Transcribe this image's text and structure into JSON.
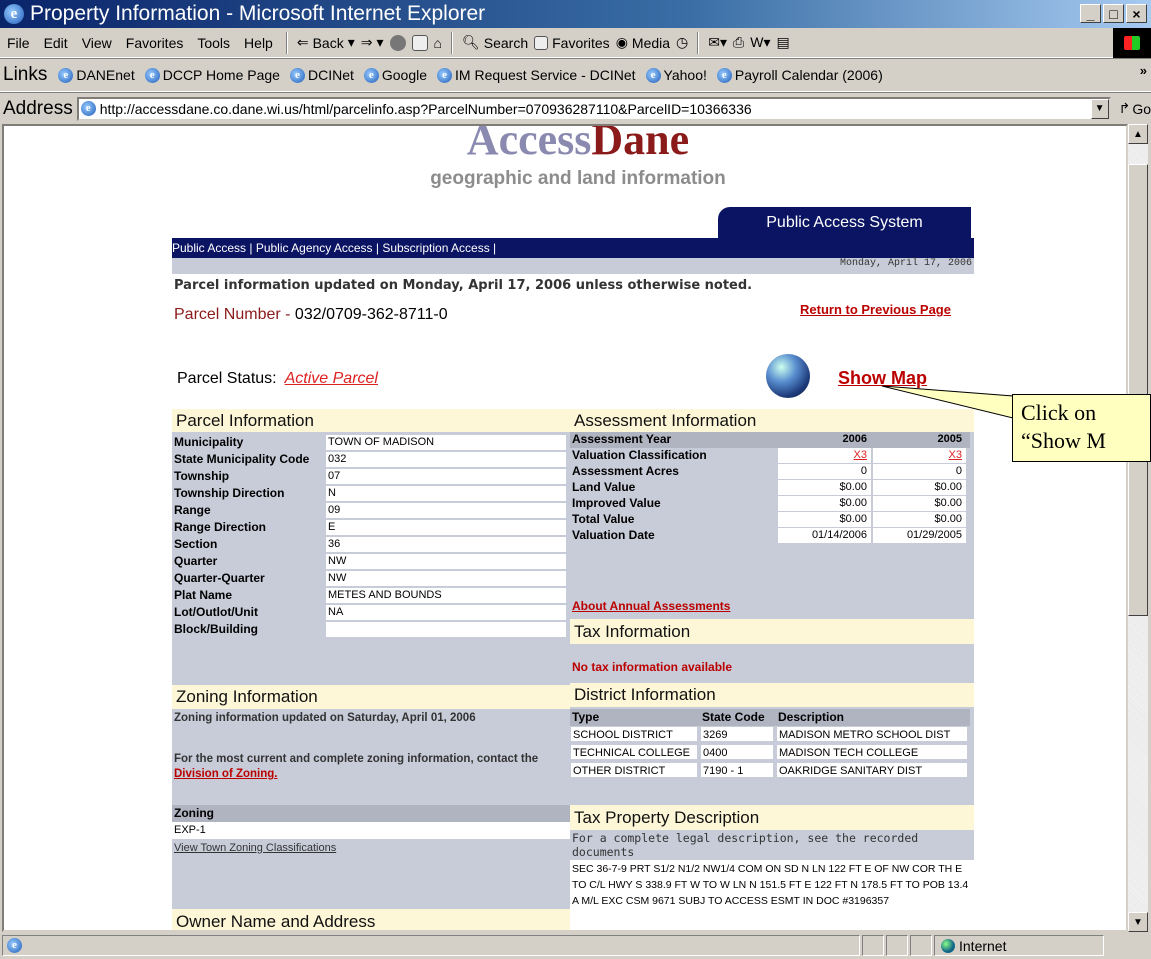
{
  "window": {
    "title": "Property Information - Microsoft Internet Explorer"
  },
  "menu": [
    "File",
    "Edit",
    "View",
    "Favorites",
    "Tools",
    "Help"
  ],
  "toolbar": {
    "back": "Back",
    "search": "Search",
    "favorites": "Favorites",
    "media": "Media"
  },
  "links": {
    "label": "Links",
    "items": [
      "DANEnet",
      "DCCP Home Page",
      "DCINet",
      "Google",
      "IM Request Service - DCINet",
      "Yahoo!",
      "Payroll Calendar (2006)"
    ]
  },
  "address": {
    "label": "Address",
    "url": "http://accessdane.co.dane.wi.us/html/parcelinfo.asp?ParcelNumber=070936287110&ParcelID=10366336",
    "go": "Go"
  },
  "page": {
    "logo_access": "Access",
    "logo_dane": "Dane",
    "logo_sub": "geographic and land information",
    "public_access_system": "Public Access System",
    "nav": "Public Access  |  Public Agency Access  | Subscription Access  |",
    "date": "Monday, April 17, 2006",
    "updated": "Parcel information updated on Monday, April 17, 2006 unless otherwise noted.",
    "parcel_label": "Parcel Number - ",
    "parcel_number": "032/0709-362-8711-0",
    "return_link": "Return to Previous Page",
    "status_label": "Parcel Status:",
    "status_value": "Active Parcel",
    "show_map": "Show Map"
  },
  "parcel_info": {
    "heading": "Parcel Information",
    "rows": [
      {
        "k": "Municipality",
        "v": "TOWN OF MADISON"
      },
      {
        "k": "State Municipality Code",
        "v": "032"
      },
      {
        "k": "Township",
        "v": "07"
      },
      {
        "k": "Township Direction",
        "v": "N"
      },
      {
        "k": "Range",
        "v": "09"
      },
      {
        "k": "Range Direction",
        "v": "E"
      },
      {
        "k": "Section",
        "v": "36"
      },
      {
        "k": "Quarter",
        "v": "NW"
      },
      {
        "k": "Quarter-Quarter",
        "v": "NW"
      },
      {
        "k": "Plat Name",
        "v": "METES AND BOUNDS"
      },
      {
        "k": "Lot/Outlot/Unit",
        "v": "NA"
      },
      {
        "k": "Block/Building",
        "v": ""
      }
    ]
  },
  "assessment": {
    "heading": "Assessment Information",
    "rows": [
      {
        "k": "Assessment Year",
        "a": "2006",
        "b": "2005"
      },
      {
        "k": "Valuation Classification",
        "a": "X3",
        "b": "X3"
      },
      {
        "k": "Assessment Acres",
        "a": "0",
        "b": "0"
      },
      {
        "k": "Land Value",
        "a": "$0.00",
        "b": "$0.00"
      },
      {
        "k": "Improved Value",
        "a": "$0.00",
        "b": "$0.00"
      },
      {
        "k": "Total Value",
        "a": "$0.00",
        "b": "$0.00"
      },
      {
        "k": "Valuation Date",
        "a": "01/14/2006",
        "b": "01/29/2005"
      }
    ],
    "about_link": "About Annual Assessments"
  },
  "tax": {
    "heading": "Tax Information",
    "none": "No tax information available"
  },
  "zoning": {
    "heading": "Zoning Information",
    "updated": "Zoning information updated on Saturday, April 01, 2006",
    "contact": "For the most current and complete zoning information, contact the",
    "contact_link": "Division of Zoning.",
    "col": "Zoning",
    "value": "EXP-1",
    "view_link": "View Town Zoning Classifications"
  },
  "district": {
    "heading": "District Information",
    "cols": [
      "Type",
      "State Code",
      "Description"
    ],
    "rows": [
      [
        "SCHOOL DISTRICT",
        "3269",
        "MADISON METRO SCHOOL DIST"
      ],
      [
        "TECHNICAL COLLEGE",
        "0400",
        "MADISON TECH COLLEGE"
      ],
      [
        "OTHER DISTRICT",
        "7190 - 1",
        "OAKRIDGE SANITARY DIST"
      ]
    ]
  },
  "tax_desc": {
    "heading": "Tax Property Description",
    "note": "For a complete legal description, see the recorded documents",
    "text": "SEC 36-7-9 PRT S1/2 N1/2 NW1/4 COM ON SD N LN 122 FT E OF NW COR TH E TO C/L HWY S 338.9 FT W TO W LN N 151.5 FT E 122 FT N 178.5 FT TO POB 13.4 A M/L EXC CSM 9671 SUBJ TO ACCESS ESMT IN DOC #3196357"
  },
  "owner": {
    "heading": "Owner Name and Address"
  },
  "callout": {
    "line1": "Click on",
    "line2": "“Show M"
  },
  "status": {
    "zone": "Internet"
  }
}
